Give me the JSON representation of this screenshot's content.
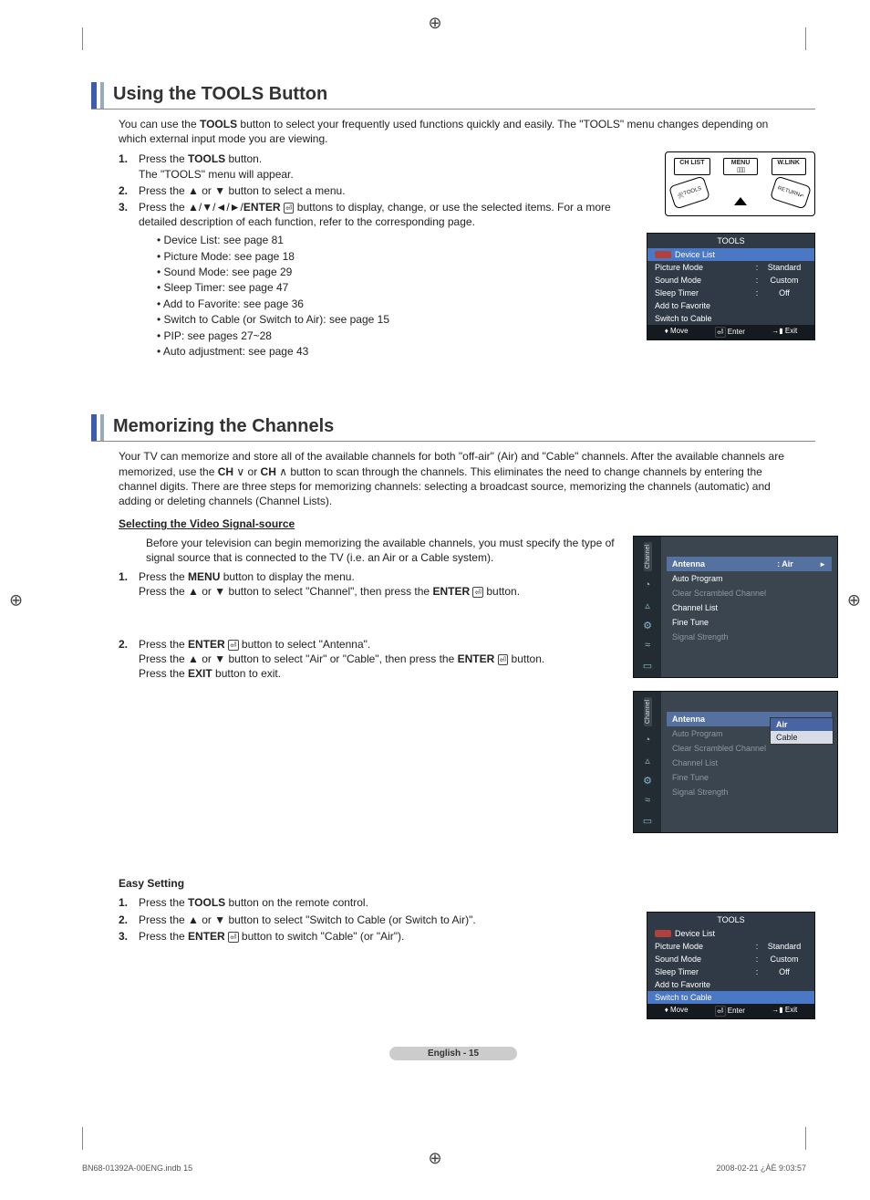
{
  "crop_glyph": "⊕",
  "section1": {
    "title": "Using the TOOLS Button",
    "intro": "You can use the TOOLS button to select your frequently used functions quickly and easily. The \"TOOLS\" menu changes depending on which external input mode you are viewing.",
    "steps": [
      {
        "num": "1.",
        "text_a": "Press the ",
        "bold_a": "TOOLS",
        "text_b": " button.",
        "sub": "The \"TOOLS\" menu will appear."
      },
      {
        "num": "2.",
        "text_a": "Press the ▲ or ▼ button to select a menu."
      },
      {
        "num": "3.",
        "text_a": "Press the ▲/▼/◄/►/",
        "bold_a": "ENTER",
        "enter_icon": true,
        "text_b": " buttons to display, change, or use the selected items. For a more detailed description of each function, refer to the corresponding page."
      }
    ],
    "bullets": [
      "Device List: see page 81",
      "Picture Mode: see page 18",
      "Sound Mode: see page 29",
      "Sleep Timer: see page 47",
      "Add to Favorite: see page 36",
      "Switch to Cable (or Switch to Air): see page 15",
      "PIP: see pages 27~28",
      "Auto adjustment: see page 43"
    ],
    "remote": {
      "btn_chlist": "CH LIST",
      "btn_menu": "MENU",
      "btn_wlink": "W.LINK",
      "btn_tools": "TOOLS",
      "btn_return": "RETURN"
    },
    "tools_osd": {
      "title": "TOOLS",
      "rows": [
        {
          "label": "Device List",
          "icon": true,
          "hl": true
        },
        {
          "label": "Picture Mode",
          "val": "Standard"
        },
        {
          "label": "Sound Mode",
          "val": "Custom"
        },
        {
          "label": "Sleep Timer",
          "val": "Off"
        },
        {
          "label": "Add to Favorite"
        },
        {
          "label": "Switch to Cable"
        }
      ],
      "footer": {
        "move": "Move",
        "enter": "Enter",
        "exit": "Exit"
      }
    }
  },
  "section2": {
    "title": "Memorizing the Channels",
    "intro": "Your TV can memorize and store all of the available channels for both \"off-air\" (Air) and \"Cable\" channels. After the available channels are memorized, use the CH ∨ or CH ∧ button to scan through the channels. This eliminates the need to change channels by entering the channel digits. There are three steps for memorizing channels: selecting a broadcast source, memorizing the channels (automatic) and adding or deleting channels (Channel Lists).",
    "sub1_title": "Selecting the Video Signal-source",
    "sub1_intro": "Before your television can begin memorizing the available channels, you must specify the type of signal source that is connected to the TV (i.e. an Air or a Cable system).",
    "sub1_steps": [
      {
        "num": "1.",
        "line1_a": "Press the ",
        "line1_bold": "MENU",
        "line1_b": " button to display the menu.",
        "line2_a": "Press the ▲ or ▼ button to select \"Channel\", then press the ",
        "line2_bold": "ENTER",
        "enter_icon": true,
        "line2_b": " button."
      },
      {
        "num": "2.",
        "line1_a": "Press the ",
        "line1_bold": "ENTER",
        "enter_icon1": true,
        "line1_b": " button to select \"Antenna\".",
        "line2_a": "Press the ▲ or ▼ button to select \"Air\" or \"Cable\", then press the ",
        "line2_bold": "ENTER",
        "enter_icon2": true,
        "line2_b": " button.",
        "line3_a": "Press the ",
        "line3_bold": "EXIT",
        "line3_b": " button to exit."
      }
    ],
    "sub2_title": "Easy Setting",
    "sub2_steps": [
      {
        "num": "1.",
        "text_a": "Press the ",
        "bold_a": "TOOLS",
        "text_b": " button on the remote control."
      },
      {
        "num": "2.",
        "text_a": "Press the ▲ or ▼ button to select \"Switch to Cable (or Switch to Air)\"."
      },
      {
        "num": "3.",
        "text_a": "Press the ",
        "bold_a": "ENTER",
        "enter_icon": true,
        "text_b": " button to switch \"Cable\" (or \"Air\")."
      }
    ],
    "menu_osd1": {
      "tab": "Channel",
      "rows": [
        {
          "label": "Antenna",
          "val": ": Air",
          "sel": true,
          "arrow": true
        },
        {
          "label": "Auto Program"
        },
        {
          "label": "Clear Scrambled Channel",
          "dim": true
        },
        {
          "label": "Channel List"
        },
        {
          "label": "Fine Tune"
        },
        {
          "label": "Signal Strength",
          "dim": true
        }
      ]
    },
    "menu_osd2": {
      "tab": "Channel",
      "rows": [
        {
          "label": "Antenna",
          "sel": true
        },
        {
          "label": "Auto Program",
          "dim": true
        },
        {
          "label": "Clear Scrambled Channel",
          "dim": true
        },
        {
          "label": "Channel List",
          "dim": true
        },
        {
          "label": "Fine Tune",
          "dim": true
        },
        {
          "label": "Signal Strength",
          "dim": true
        }
      ],
      "popup": [
        {
          "label": "Air",
          "sel": true
        },
        {
          "label": "Cable"
        }
      ]
    },
    "tools_osd2": {
      "title": "TOOLS",
      "rows": [
        {
          "label": "Device List",
          "icon": true
        },
        {
          "label": "Picture Mode",
          "val": "Standard"
        },
        {
          "label": "Sound Mode",
          "val": "Custom"
        },
        {
          "label": "Sleep Timer",
          "val": "Off"
        },
        {
          "label": "Add to Favorite"
        },
        {
          "label": "Switch to Cable",
          "hl": true
        }
      ],
      "footer": {
        "move": "Move",
        "enter": "Enter",
        "exit": "Exit"
      }
    }
  },
  "footer": {
    "page": "English - 15",
    "doc": "BN68-01392A-00ENG.indb   15",
    "date": "2008-02-21   ¿ÀÈ 9:03:57"
  }
}
